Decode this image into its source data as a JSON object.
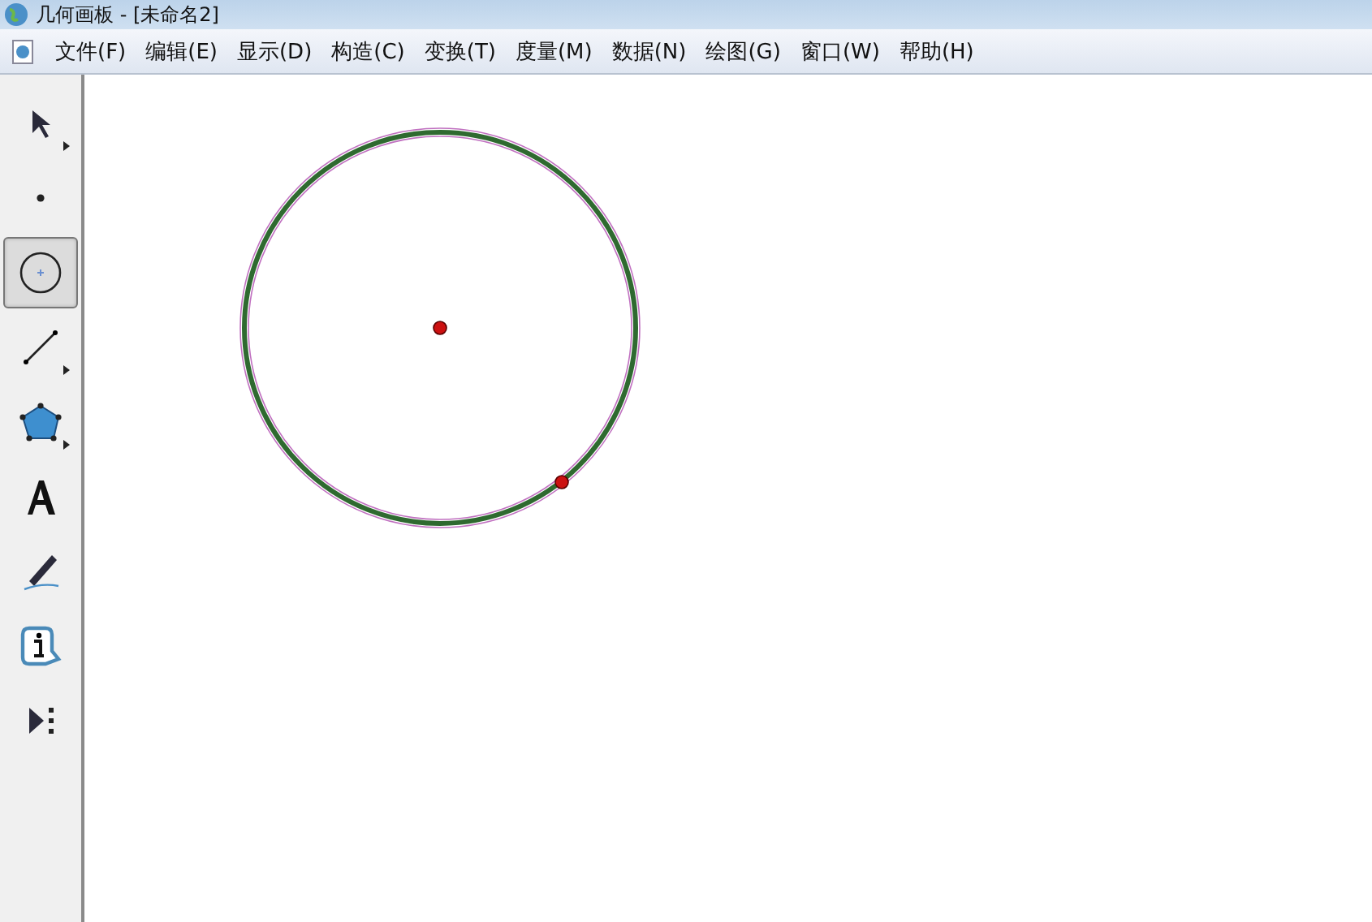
{
  "window": {
    "title": "几何画板 - [未命名2]"
  },
  "menu": [
    "文件(F)",
    "编辑(E)",
    "显示(D)",
    "构造(C)",
    "变换(T)",
    "度量(M)",
    "数据(N)",
    "绘图(G)",
    "窗口(W)",
    "帮助(H)"
  ],
  "tools": [
    {
      "kind": "arrow",
      "selected": false,
      "submenu": true
    },
    {
      "kind": "point",
      "selected": false,
      "submenu": false
    },
    {
      "kind": "compass",
      "selected": true,
      "submenu": false
    },
    {
      "kind": "line",
      "selected": false,
      "submenu": true
    },
    {
      "kind": "polygon",
      "selected": false,
      "submenu": true
    },
    {
      "kind": "text",
      "selected": false,
      "submenu": false
    },
    {
      "kind": "marker",
      "selected": false,
      "submenu": false
    },
    {
      "kind": "info",
      "selected": false,
      "submenu": false
    },
    {
      "kind": "custom",
      "selected": false,
      "submenu": false
    }
  ],
  "canvas": {
    "circle": {
      "selected": true
    }
  }
}
